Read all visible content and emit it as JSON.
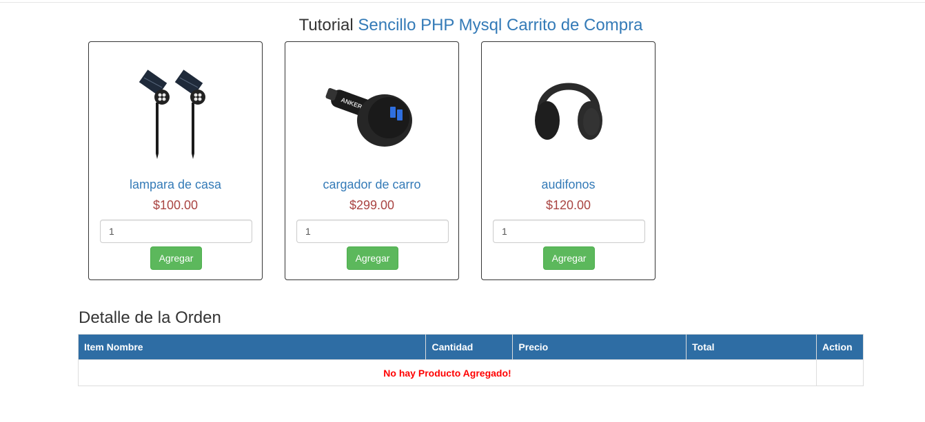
{
  "header": {
    "title_prefix": "Tutorial",
    "title_accent": "Sencillo PHP Mysql Carrito de Compra"
  },
  "products": [
    {
      "name": "lampara de casa",
      "price": "$100.00",
      "quantity": "1",
      "button_label": "Agregar",
      "image_icon": "solar-lamp-icon"
    },
    {
      "name": "cargador de carro",
      "price": "$299.00",
      "quantity": "1",
      "button_label": "Agregar",
      "image_icon": "car-charger-icon"
    },
    {
      "name": "audifonos",
      "price": "$120.00",
      "quantity": "1",
      "button_label": "Agregar",
      "image_icon": "headphones-icon"
    }
  ],
  "order": {
    "heading": "Detalle de la Orden",
    "columns": [
      "Item Nombre",
      "Cantidad",
      "Precio",
      "Total",
      "Action"
    ],
    "empty_message": "No hay Producto Agregado!"
  },
  "charger_brand": "ANKER",
  "colors": {
    "link_blue": "#337ab7",
    "price_red": "#a94442",
    "button_green": "#5cb85c",
    "table_header": "#2e6da4",
    "empty_message": "#ff0000"
  }
}
